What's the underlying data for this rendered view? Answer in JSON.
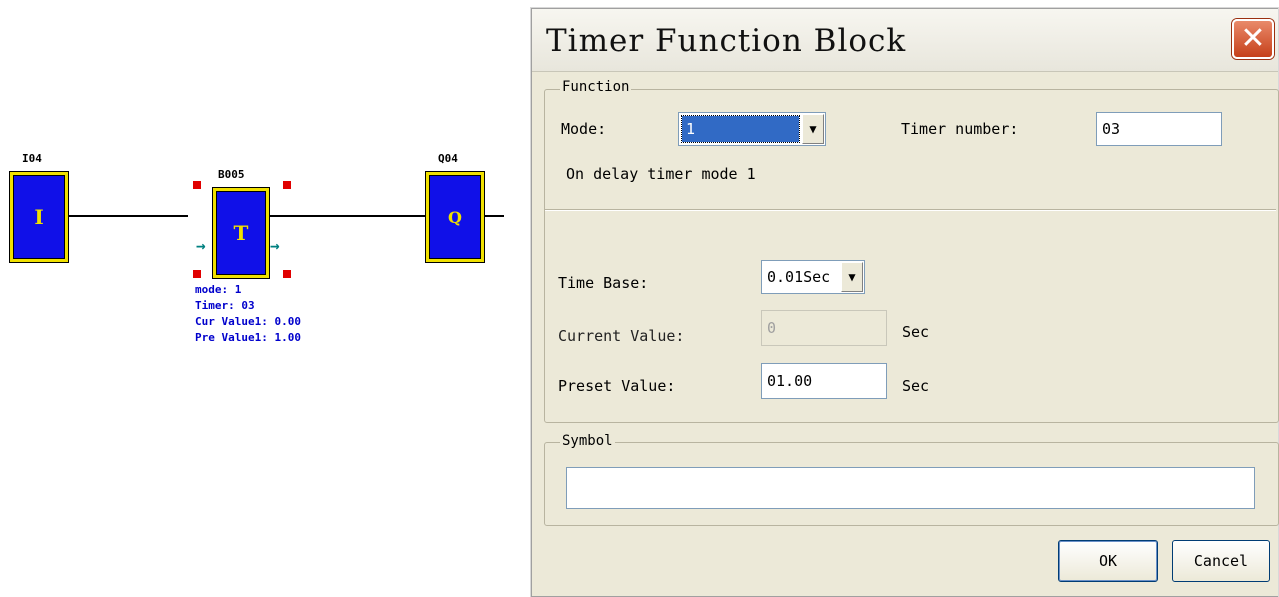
{
  "diagram": {
    "input_block": {
      "tag": "I04",
      "letter": "I"
    },
    "timer_block": {
      "tag": "B005",
      "letter": "T"
    },
    "output_block": {
      "tag": "Q04",
      "letter": "Q"
    },
    "timer_info": {
      "mode": "mode: 1",
      "timer": "Timer: 03",
      "cur_value": "Cur Value1: 0.00",
      "pre_value": "Pre Value1: 1.00"
    },
    "colors": {
      "block_fill": "#1010e8",
      "block_border": "#f0e000",
      "handle": "#e00000",
      "arrow": "#008080",
      "info_text": "#0000cc"
    }
  },
  "dialog": {
    "title": "Timer Function Block",
    "close_glyph": "✕",
    "function_group": {
      "label": "Function",
      "mode_label": "Mode:",
      "mode_value": "1",
      "timer_number_label": "Timer number:",
      "timer_number_value": "03",
      "description": "On delay timer mode 1"
    },
    "time_group": {
      "time_base_label": "Time Base:",
      "time_base_value": "0.01Sec",
      "current_value_label": "Current Value:",
      "current_value": "0",
      "current_unit": "Sec",
      "preset_value_label": "Preset Value:",
      "preset_value": "01.00",
      "preset_unit": "Sec"
    },
    "symbol_group": {
      "label": "Symbol",
      "value": ""
    },
    "buttons": {
      "ok": "OK",
      "cancel": "Cancel"
    }
  }
}
